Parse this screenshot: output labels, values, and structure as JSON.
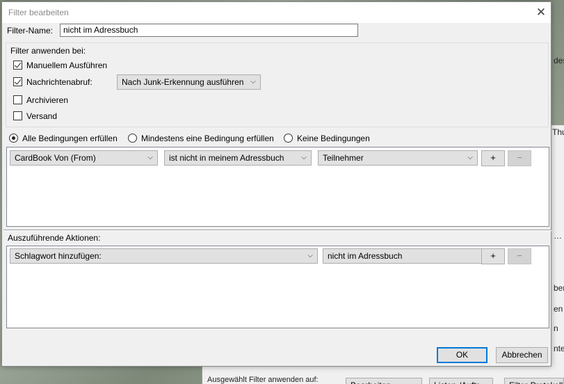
{
  "dialog": {
    "title": "Filter bearbeiten",
    "filter_name_label": "Filter-Name:",
    "filter_name_value": "nicht im Adressbuch"
  },
  "apply_group": {
    "legend": "Filter anwenden bei:",
    "options": [
      {
        "label": "Manuellem Ausführen",
        "checked": true
      },
      {
        "label": "Nachrichtenabruf:",
        "checked": true
      },
      {
        "label": "Archivieren",
        "checked": false
      },
      {
        "label": "Versand",
        "checked": false
      }
    ],
    "junk_select": "Nach Junk-Erkennung ausführen"
  },
  "match": {
    "options": [
      {
        "label": "Alle Bedingungen erfüllen",
        "selected": true
      },
      {
        "label": "Mindestens eine Bedingung erfüllen",
        "selected": false
      },
      {
        "label": "Keine Bedingungen",
        "selected": false
      }
    ]
  },
  "condition": {
    "field": "CardBook Von (From)",
    "operator": "ist nicht in meinem Adressbuch",
    "value": "Teilnehmer",
    "add": "+",
    "remove": "−"
  },
  "actions": {
    "label": "Auszuführende Aktionen:",
    "action": "Schlagwort hinzufügen:",
    "value": "nicht im Adressbuch",
    "add": "+",
    "remove": "−"
  },
  "buttons": {
    "ok": "OK",
    "cancel": "Abbrechen"
  },
  "background": {
    "fragments": [
      "des",
      "Thu",
      "ber",
      "en",
      "n",
      "nte",
      "…"
    ],
    "bottom_buttons": [
      "Ausgewählt Filter anwenden auf:",
      "Bearbeiten",
      "Listen-/Auftr.",
      "Filter-Protokoll"
    ]
  }
}
